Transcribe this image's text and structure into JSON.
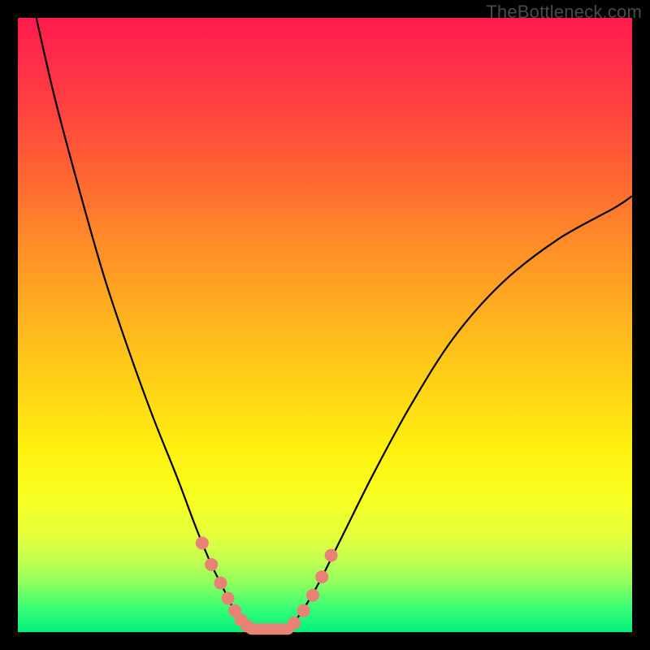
{
  "watermark": "TheBottleneck.com",
  "colors": {
    "frame": "#000000",
    "curve": "#000000",
    "bead": "#e88274",
    "gradient_top": "#ff1a4d",
    "gradient_bottom": "#00f07c"
  },
  "chart_data": {
    "type": "line",
    "title": "",
    "xlabel": "",
    "ylabel": "",
    "xlim": [
      0,
      100
    ],
    "ylim": [
      0,
      100
    ],
    "note": "No axis ticks or labels are rendered in the image; values are positional estimates (0-100 normalized).",
    "series": [
      {
        "name": "left-curve",
        "x": [
          3,
          6,
          10,
          14,
          18,
          22,
          26,
          29,
          31.5,
          33.5,
          35,
          36.5,
          38
        ],
        "y": [
          100,
          87,
          72,
          58,
          46,
          35,
          25,
          17,
          11,
          7,
          4,
          2,
          0.5
        ]
      },
      {
        "name": "right-curve",
        "x": [
          44,
          46,
          49,
          53,
          58,
          64,
          71,
          79,
          88,
          97,
          100
        ],
        "y": [
          0.5,
          3,
          8,
          16,
          26,
          37,
          48,
          57,
          64,
          69,
          71
        ]
      },
      {
        "name": "floor-segment",
        "x": [
          38,
          44
        ],
        "y": [
          0.5,
          0.5
        ]
      }
    ],
    "beads": {
      "left": [
        {
          "x": 30.0,
          "y": 14.5
        },
        {
          "x": 31.5,
          "y": 11.0
        },
        {
          "x": 33.0,
          "y": 8.0
        },
        {
          "x": 34.2,
          "y": 5.5
        },
        {
          "x": 35.3,
          "y": 3.5
        },
        {
          "x": 36.3,
          "y": 2.0
        },
        {
          "x": 37.3,
          "y": 1.0
        }
      ],
      "right": [
        {
          "x": 45.0,
          "y": 1.5
        },
        {
          "x": 46.5,
          "y": 3.5
        },
        {
          "x": 48.0,
          "y": 6.0
        },
        {
          "x": 49.5,
          "y": 9.0
        },
        {
          "x": 51.0,
          "y": 12.5
        }
      ]
    }
  }
}
